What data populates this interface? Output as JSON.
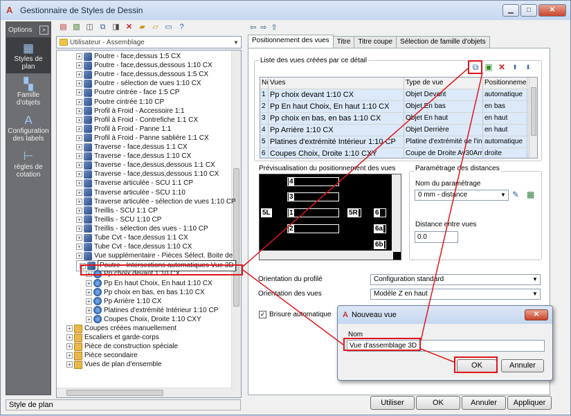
{
  "window": {
    "title": "Gestionnaire de Styles de Dessin",
    "minimize": "▁",
    "maximize": "□",
    "close": "✕"
  },
  "left_panel": {
    "options_label": "Options",
    "pin": ">",
    "items": [
      {
        "label": "Styles de plan",
        "icon": "styles-icon"
      },
      {
        "label": "Famille d'objets",
        "icon": "family-icon"
      },
      {
        "label": "Configuration des labels",
        "icon": "labels-icon"
      },
      {
        "label": "règles de cotation",
        "icon": "dimension-icon"
      }
    ]
  },
  "tree_toolbar": {
    "icons": [
      "new-style-icon",
      "copy-icon",
      "paste-icon",
      "duplicate-icon",
      "link-icon",
      "delete-icon",
      "import-icon",
      "export-icon",
      "display-icon",
      "help-icon"
    ]
  },
  "combo": {
    "value": "Utilisateur - Assemblage"
  },
  "tree": {
    "rows": [
      {
        "label": "Poutre - face,dessus 1:5 CX"
      },
      {
        "label": "Poutre - face,dessus,dessous 1:10 CX"
      },
      {
        "label": "Poutre - face,dessus,dessous 1:5 CX"
      },
      {
        "label": "Poutre - sélection de vues 1:10 CX"
      },
      {
        "label": "Poutre cintrée - face 1:5 CP"
      },
      {
        "label": "Poutre cintrée 1:10 CP"
      },
      {
        "label": "Profil à Froid - Accessoire 1:1"
      },
      {
        "label": "Profil à Froid - Contrefiche 1:1 CX"
      },
      {
        "label": "Profil à Froid - Panne 1:1"
      },
      {
        "label": "Profil à Froid - Panne sablière 1:1 CX"
      },
      {
        "label": "Traverse - face,dessus 1:1 CX"
      },
      {
        "label": "Traverse - face,dessus 1:10 CX"
      },
      {
        "label": "Traverse - face,dessus,dessous 1:1 CX"
      },
      {
        "label": "Traverse - face,dessus,dessous 1:10 CX"
      },
      {
        "label": "Traverse articulée - SCU 1:1 CP"
      },
      {
        "label": "Traverse articulée - SCU 1:10"
      },
      {
        "label": "Traverse articulée - sélection de vues 1:10 CP"
      },
      {
        "label": "Treillis - SCU 1:1 CP"
      },
      {
        "label": "Treillis - SCU 1:10 CP"
      },
      {
        "label": "Treillis - sélection des vues - 1:10 CP"
      },
      {
        "label": "Tube Cvt - face,dessus 1:1 CX"
      },
      {
        "label": "Tube Cvt - face,dessus 1:10 CX"
      },
      {
        "label": "Vue supplémentaire - Pièces Sélect. Boite de"
      },
      {
        "label": "Poutre - Intersections automatiques Vue 3D"
      }
    ],
    "children": [
      {
        "label": "Pp choix devant 1:10 CX"
      },
      {
        "label": "Pp En haut Choix, En haut 1:10 CX"
      },
      {
        "label": "Pp choix en bas, en bas 1:10 CX"
      },
      {
        "label": "Pp Arrière 1:10 CX"
      },
      {
        "label": "Platines d'extrémité Intérieur 1:10 CP"
      },
      {
        "label": "Coupes Choix, Droite 1:10 CXY"
      }
    ],
    "folders": [
      {
        "label": "Coupes créées manuellement"
      },
      {
        "label": "Escaliers et garde-corps"
      },
      {
        "label": "Pièce de construction spéciale"
      },
      {
        "label": "Pièce secondaire"
      },
      {
        "label": "Vues de plan d'ensemble"
      }
    ]
  },
  "nav": {
    "back": "⇦",
    "forward": "⇨",
    "up": "⇧"
  },
  "tabs": [
    {
      "label": "Positionnement des vues"
    },
    {
      "label": "Titre"
    },
    {
      "label": "Titre coupe"
    },
    {
      "label": "Sélection de famille d'objets"
    }
  ],
  "views_group": {
    "label": "Liste des vues créées par ce détail",
    "tools": [
      {
        "icon": "copy-view-icon",
        "glyph": "⧉"
      },
      {
        "icon": "add-view-icon",
        "glyph": "▣"
      },
      {
        "icon": "delete-view-icon",
        "glyph": "✕"
      },
      {
        "icon": "move-up-icon",
        "glyph": "⬆"
      },
      {
        "icon": "move-down-icon",
        "glyph": "⬇"
      }
    ],
    "columns": [
      "No",
      "Vues",
      "Type de vue",
      "Positionneme"
    ],
    "rows": [
      [
        "1",
        "Pp choix devant 1:10 CX",
        "Objet Devant",
        "automatique"
      ],
      [
        "2",
        "Pp En haut Choix, En haut 1:10 CX",
        "Objet En bas",
        "en bas"
      ],
      [
        "3",
        "Pp choix en bas, en bas 1:10 CX",
        "Objet En haut",
        "en haut"
      ],
      [
        "4",
        "Pp Arrière 1:10 CX",
        "Objet Derrière",
        "en haut"
      ],
      [
        "5",
        "Platines d'extrémité Intérieur 1:10 CP",
        "Platine d'extrémité de l'in",
        "automatique"
      ],
      [
        "6",
        "Coupes Choix, Droite 1:10 CXY",
        "Coupe de Droite Av30Arr",
        "droite"
      ]
    ]
  },
  "preview": {
    "label": "Prévisualisation du positionnement des vues",
    "labels": [
      "4",
      "3",
      "5L",
      "1",
      "5R",
      "6",
      "2",
      "6a",
      "6b"
    ]
  },
  "distances": {
    "label": "Paramétrage des distances",
    "name_label": "Nom du paramétrage",
    "name_value": "0 mm - distance",
    "between_label": "Distance entre vues",
    "between_value": "0.0"
  },
  "profile": {
    "label": "Orientation du profilé",
    "value": "Configuration standard"
  },
  "views_orient": {
    "label": "Orientation des vues",
    "value": "Modèle Z en haut"
  },
  "auto_break": {
    "label": "Brisure automatique",
    "checked": "✓"
  },
  "buttons": {
    "use": "Utiliser",
    "ok": "OK",
    "cancel": "Annuler",
    "apply": "Appliquer"
  },
  "status": {
    "text": "Style de plan"
  },
  "dialog": {
    "title": "Nouveau vue",
    "name_label": "Nom",
    "name_value": "Vue d'assemblage 3D",
    "ok": "OK",
    "cancel": "Annuler",
    "close": "✕"
  }
}
